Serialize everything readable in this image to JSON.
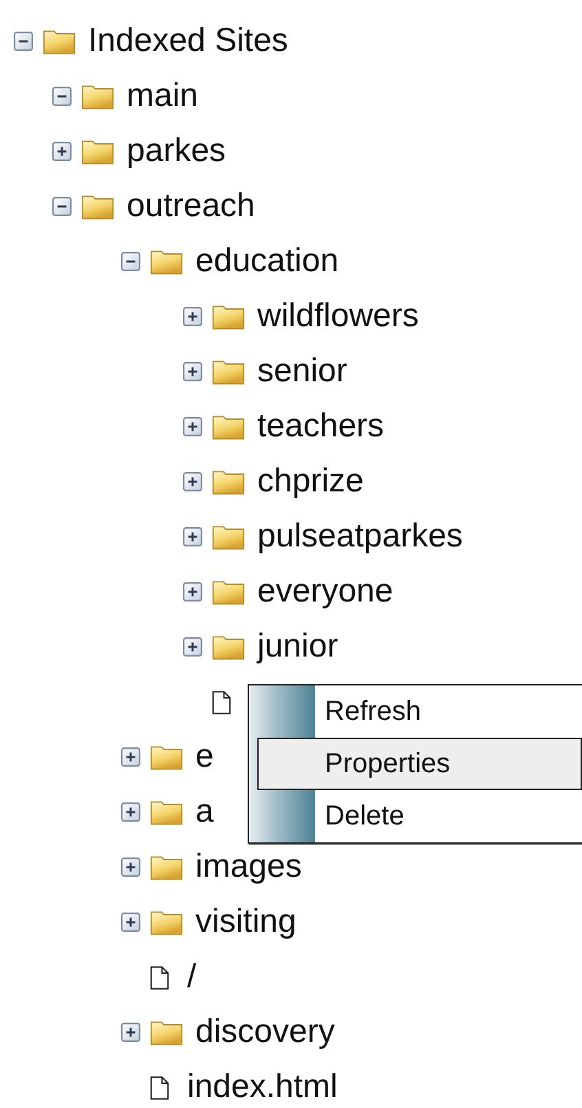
{
  "tree": {
    "label": "Indexed Sites",
    "kind": "folder",
    "expanded": true,
    "children": [
      {
        "label": "main",
        "kind": "folder",
        "expanded": true
      },
      {
        "label": "parkes",
        "kind": "folder",
        "expanded": false
      },
      {
        "label": "outreach",
        "kind": "folder",
        "expanded": true,
        "children": [
          {
            "label": "education",
            "kind": "folder",
            "expanded": true,
            "children": [
              {
                "label": "wildflowers",
                "kind": "folder",
                "expanded": false
              },
              {
                "label": "senior",
                "kind": "folder",
                "expanded": false
              },
              {
                "label": "teachers",
                "kind": "folder",
                "expanded": false
              },
              {
                "label": "chprize",
                "kind": "folder",
                "expanded": false
              },
              {
                "label": "pulseatparkes",
                "kind": "folder",
                "expanded": false
              },
              {
                "label": "everyone",
                "kind": "folder",
                "expanded": false
              },
              {
                "label": "junior",
                "kind": "folder",
                "expanded": false
              },
              {
                "kind": "file"
              }
            ]
          },
          {
            "label": "e",
            "kind": "folder",
            "expanded": false
          },
          {
            "label": "a",
            "kind": "folder",
            "expanded": false
          },
          {
            "label": "images",
            "kind": "folder",
            "expanded": false
          },
          {
            "label": "visiting",
            "kind": "folder",
            "expanded": false
          },
          {
            "label": "/",
            "kind": "file"
          },
          {
            "label": "discovery",
            "kind": "folder",
            "expanded": false
          },
          {
            "label": "index.html",
            "kind": "file"
          }
        ]
      }
    ]
  },
  "context_menu": {
    "items": [
      {
        "label": "Refresh",
        "selected": false
      },
      {
        "label": "Properties",
        "selected": true
      },
      {
        "label": "Delete",
        "selected": false
      }
    ]
  }
}
